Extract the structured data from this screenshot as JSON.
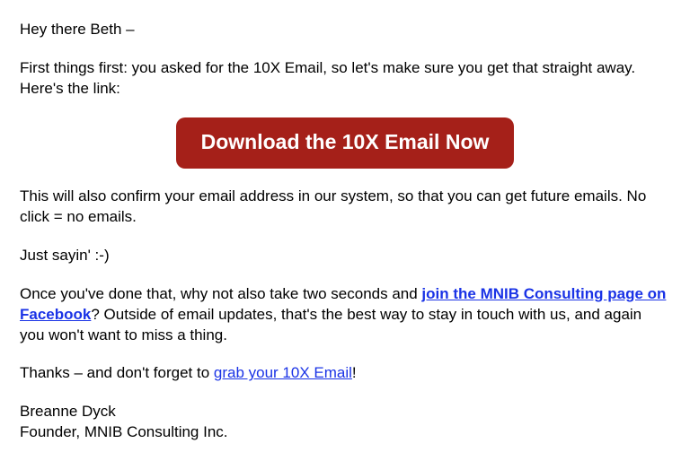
{
  "greeting": "Hey there Beth –",
  "intro": "First things first: you asked for the 10X Email, so let's make sure you get that straight away. Here's the link:",
  "cta_button": "Download the 10X Email Now",
  "confirm_text": "This will also confirm your email address in our system, so that you can get future emails. No click = no emails.",
  "just_sayin": "Just sayin' :-)",
  "facebook_prefix": "Once you've done that, why not also take two seconds and ",
  "facebook_link": "join the MNIB Consulting page on Facebook",
  "facebook_suffix": "? Outside of email updates, that's the best way to stay in touch with us, and again you won't want to miss a thing.",
  "thanks_prefix": "Thanks – and don't forget to ",
  "thanks_link": "grab your 10X Email",
  "thanks_suffix": "!",
  "signature_name": "Breanne Dyck",
  "signature_title": "Founder, MNIB Consulting Inc."
}
